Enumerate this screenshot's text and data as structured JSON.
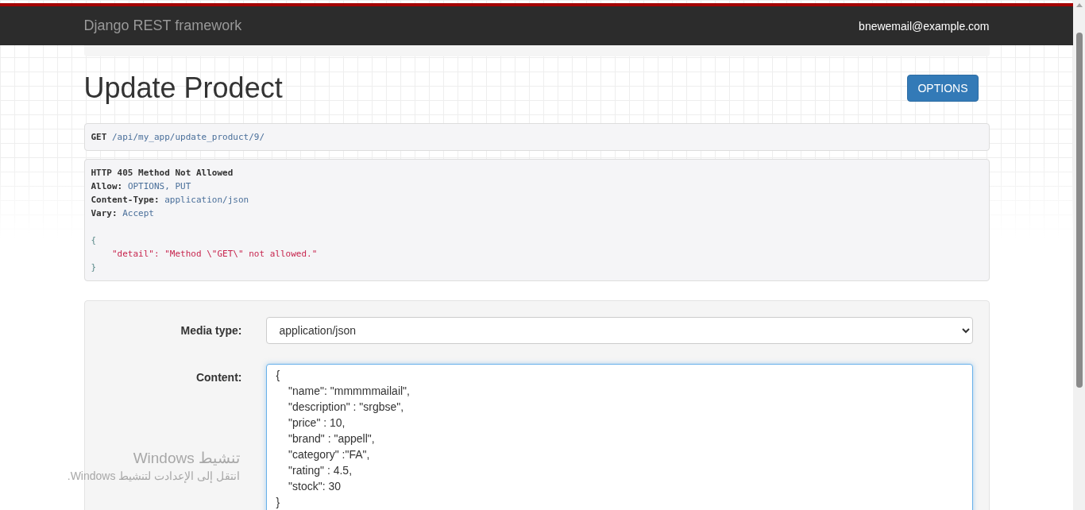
{
  "navbar": {
    "brand": "Django REST framework",
    "user": "bnewemail@example.com"
  },
  "page": {
    "title": "Update Prodect",
    "options_button": "OPTIONS"
  },
  "request": {
    "method": "GET",
    "path": "/api/my_app/update_product/9/"
  },
  "response": {
    "status": "HTTP 405 Method Not Allowed",
    "headers": [
      {
        "name": "Allow:",
        "value": "OPTIONS, PUT"
      },
      {
        "name": "Content-Type:",
        "value": "application/json"
      },
      {
        "name": "Vary:",
        "value": "Accept"
      }
    ],
    "body_open": "{",
    "body_lines": [
      "\"detail\": \"Method \\\"GET\\\" not allowed.\""
    ],
    "body_close": "}"
  },
  "form": {
    "media_type_label": "Media type:",
    "media_type_value": "application/json",
    "content_label": "Content:",
    "content_lines": [
      "{",
      "    \"name\": \"mmmmmailail\",",
      "    \"description\" : \"srgbse\",",
      "    \"price\" : 10,",
      "    \"brand\" : \"appell\",",
      "    \"category\" :\"FA\",",
      "    \"rating\" : 4.5,",
      "    \"stock\": 30",
      "}"
    ]
  },
  "os_overlay": {
    "title": "تنشيط Windows",
    "message": "انتقل إلى الإعدادت لتنشيط Windows."
  }
}
